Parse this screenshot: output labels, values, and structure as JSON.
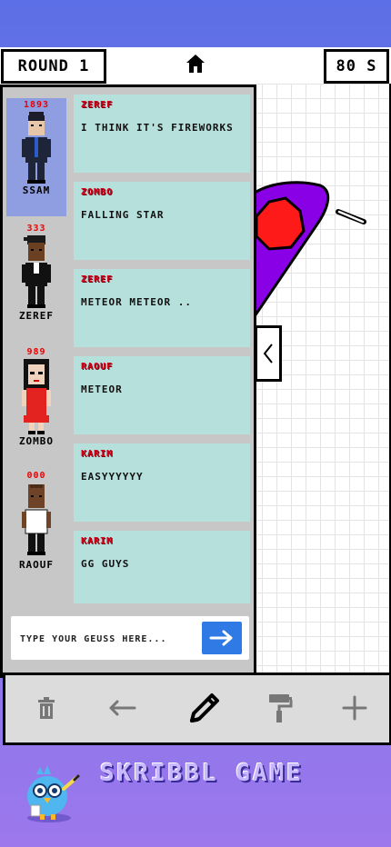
{
  "header": {
    "round_label": "ROUND 1",
    "time_label": "80 S"
  },
  "players": [
    {
      "score": "1893",
      "name": "SSAM",
      "active": true
    },
    {
      "score": "333",
      "name": "ZEREF",
      "active": false
    },
    {
      "score": "989",
      "name": "ZOMBO",
      "active": false
    },
    {
      "score": "000",
      "name": "RAOUF",
      "active": false
    }
  ],
  "messages": [
    {
      "sender": "ZEREF",
      "text": "I THINK IT'S FIREWORKS"
    },
    {
      "sender": "ZOMBO",
      "text": "FALLING STAR"
    },
    {
      "sender": "ZEREF",
      "text": "METEOR METEOR .."
    },
    {
      "sender": "RAOUF",
      "text": "METEOR"
    },
    {
      "sender": "KARIM",
      "text": "EASYYYYYY"
    },
    {
      "sender": "KARIM",
      "text": "GG GUYS"
    }
  ],
  "guess_input": {
    "placeholder": "TYPE YOUR GEUSS HERE...",
    "value": ""
  },
  "toolbar": {
    "tools": [
      "trash-icon",
      "arrow-left-icon",
      "pencil-icon",
      "paint-roller-icon",
      "plus-icon"
    ],
    "selected": "pencil-icon"
  },
  "footer": {
    "title": "SKRIBBL GAME"
  },
  "colors": {
    "accent": "#2f7ae5",
    "message_bg": "#b6e0dc",
    "sender": "#d4001a",
    "active_player": "#8f9ee0",
    "drawing_purple": "#8a00e6",
    "drawing_red": "#ff1a1a"
  }
}
